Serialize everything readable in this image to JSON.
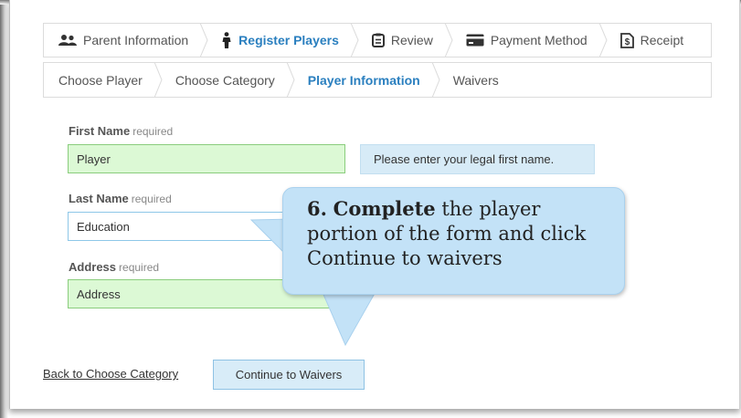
{
  "steps_main": [
    {
      "label": "Parent Information",
      "icon": "users-icon"
    },
    {
      "label": "Register Players",
      "icon": "person-icon",
      "active": true
    },
    {
      "label": "Review",
      "icon": "clipboard-icon"
    },
    {
      "label": "Payment Method",
      "icon": "credit-card-icon"
    },
    {
      "label": "Receipt",
      "icon": "receipt-icon"
    }
  ],
  "steps_sub": [
    {
      "label": "Choose Player"
    },
    {
      "label": "Choose Category"
    },
    {
      "label": "Player Information",
      "active": true
    },
    {
      "label": "Waivers"
    }
  ],
  "form": {
    "first_name": {
      "label": "First Name",
      "required": "required",
      "value": "Player"
    },
    "last_name": {
      "label": "Last Name",
      "required": "required",
      "value": "Education"
    },
    "address": {
      "label": "Address",
      "required": "required",
      "value": "Address"
    },
    "first_name_hint": "Please enter your legal first name."
  },
  "callout": {
    "number": "6.",
    "bold": "Complete",
    "rest": "the player portion of the form and click Continue to waivers",
    "line1_rest": "the player",
    "line2": "portion of the form and click",
    "line3": "Continue to waivers"
  },
  "actions": {
    "back_label": "Back to Choose Category",
    "continue_label": "Continue to Waivers"
  },
  "colors": {
    "active": "#2a7fbf",
    "valid_fill": "#dcf9d5",
    "valid_border": "#8acd7d",
    "hint_fill": "#d7ebf7",
    "callout_fill": "#c3e2f7",
    "button_fill": "#d8ecf8"
  }
}
